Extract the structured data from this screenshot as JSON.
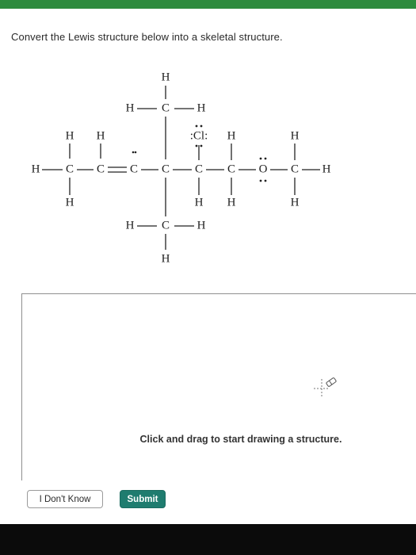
{
  "prompt": "Convert the Lewis structure below into a skeletal structure.",
  "lewis": {
    "H": "H",
    "C": "C",
    "Cl": ":Cl:",
    "O": "O"
  },
  "canvas": {
    "hint": "Click and drag to start drawing a structure."
  },
  "buttons": {
    "dont_know": "I Don't Know",
    "submit": "Submit"
  },
  "colors": {
    "top_bar": "#2e8b3e",
    "submit": "#1f7c6f"
  }
}
